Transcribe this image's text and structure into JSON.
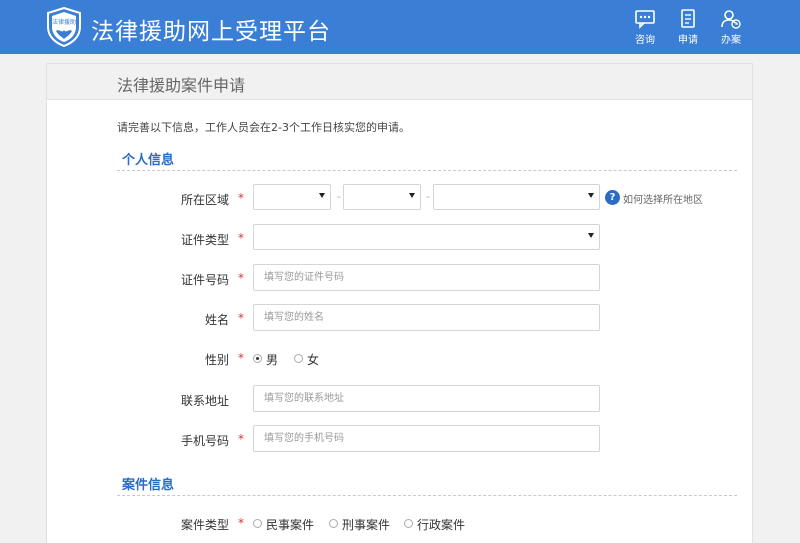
{
  "header": {
    "title": "法律援助网上受理平台",
    "logo_text": "法律援助",
    "nav": [
      {
        "label": "咨询",
        "icon": "chat-icon"
      },
      {
        "label": "申请",
        "icon": "form-icon"
      },
      {
        "label": "办案",
        "icon": "case-icon"
      }
    ]
  },
  "page": {
    "title": "法律援助案件申请",
    "intro": "请完善以下信息，工作人员会在2-3个工作日核实您的申请。"
  },
  "personal": {
    "section_title": "个人信息",
    "region": {
      "label": "所在区域",
      "dash": "-",
      "help": "如何选择所在地区",
      "help_icon": "?"
    },
    "id_type": {
      "label": "证件类型"
    },
    "id_number": {
      "label": "证件号码",
      "placeholder": "填写您的证件号码"
    },
    "name": {
      "label": "姓名",
      "placeholder": "填写您的姓名"
    },
    "gender": {
      "label": "性别",
      "options": [
        "男",
        "女"
      ],
      "selected": "男"
    },
    "address": {
      "label": "联系地址",
      "placeholder": "填写您的联系地址"
    },
    "phone": {
      "label": "手机号码",
      "placeholder": "填写您的手机号码"
    }
  },
  "case": {
    "section_title": "案件信息",
    "case_type": {
      "label": "案件类型",
      "options": [
        "民事案件",
        "刑事案件",
        "行政案件"
      ]
    }
  },
  "required_mark": "*",
  "colors": {
    "header": "#3a7fd5",
    "accent": "#2b6cc4",
    "required": "#e03333"
  }
}
